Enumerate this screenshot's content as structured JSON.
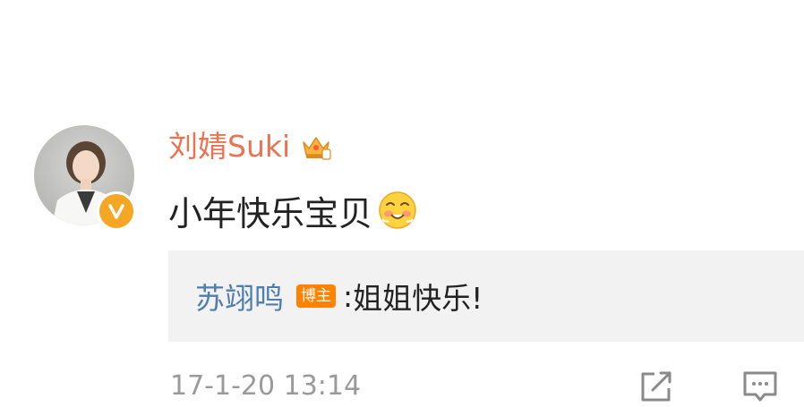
{
  "comment": {
    "username": "刘婧Suki",
    "text": "小年快乐宝贝",
    "avatar_icon": "avatar",
    "verified_icon": "verified-v-icon",
    "member_icon": "crown-icon",
    "emoji_icon": "blush-emoji-icon",
    "timestamp": "17-1-20 13:14"
  },
  "reply": {
    "username": "苏翊鸣",
    "badge": "博主",
    "separator": ":",
    "text": "姐姐快乐!"
  },
  "actions": {
    "share_icon": "share-icon",
    "comment_icon": "comment-icon"
  },
  "colors": {
    "username": "#eb7350",
    "reply_username": "#507daf",
    "badge_bg": "#ff8200",
    "verified_bg": "#f5a623",
    "reply_bg": "#f2f2f2",
    "timestamp": "#9a9a9a"
  }
}
